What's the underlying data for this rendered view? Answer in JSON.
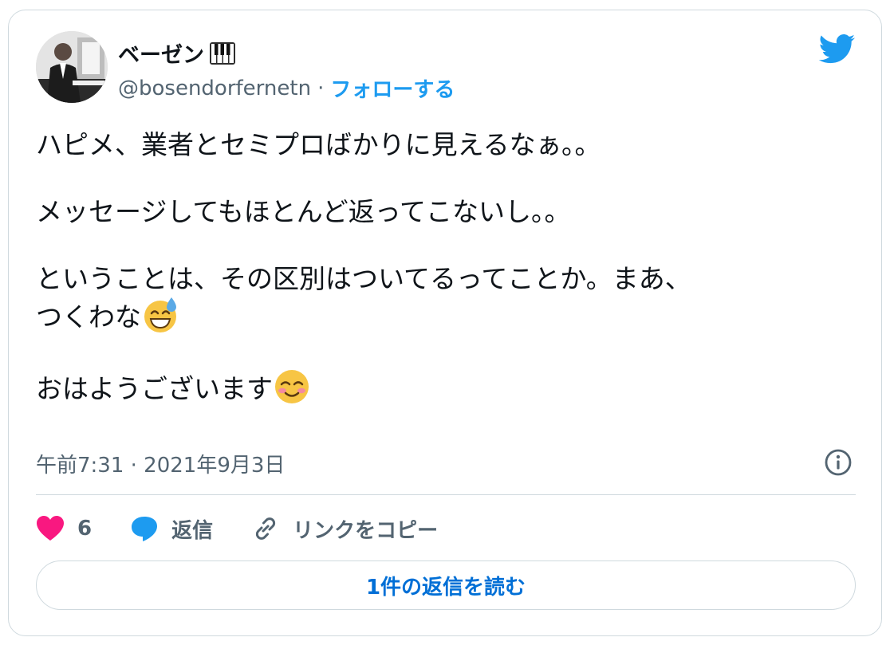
{
  "tweet": {
    "author": {
      "display_name": "ベーゼン",
      "name_emoji_icon": "piano-keys-icon",
      "handle": "@bosendorfernetn",
      "separator": "·",
      "follow_label": "フォローする"
    },
    "text_parts": [
      "ハピメ、業者とセミプロばかりに見えるなぁ。。\n\nメッセージしてもほとんど返ってこないし。。\n\nということは、その区別はついてるってことか。まあ、\nつくわな",
      "\n\nおはようございます"
    ],
    "emoji_icons": [
      "grinning-sweat-icon",
      "smiling-blush-icon"
    ],
    "timestamp": "午前7:31 · 2021年9月3日",
    "likes": {
      "count": "6",
      "icon": "heart-icon",
      "color": "#f91880"
    },
    "reply": {
      "label": "返信",
      "icon": "speech-bubble-icon",
      "color": "#1d9bf0"
    },
    "copy_link": {
      "label": "リンクをコピー",
      "icon": "link-icon"
    },
    "read_replies_label": "1件の返信を読む"
  },
  "brand": {
    "logo": "twitter-bird-icon",
    "accent": "#1d9bf0"
  }
}
